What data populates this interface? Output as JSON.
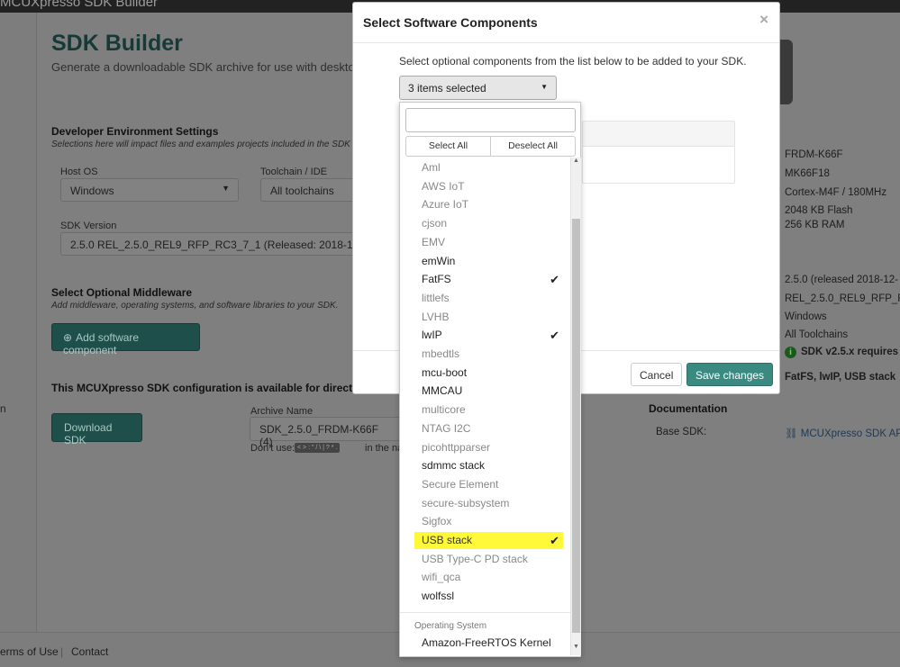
{
  "app": {
    "title": "MCUXpresso SDK Builder"
  },
  "page": {
    "title": "SDK Builder",
    "subtitle": "Generate a downloadable SDK archive for use with desktop",
    "dev_env": {
      "heading": "Developer Environment Settings",
      "desc": "Selections here will impact files and examples projects included in the SDK a",
      "host_os_label": "Host OS",
      "host_os_value": "Windows",
      "toolchain_label": "Toolchain / IDE",
      "toolchain_value": "All toolchains",
      "sdk_version_label": "SDK Version",
      "sdk_version_value": "2.5.0 REL_2.5.0_REL9_RFP_RC3_7_1 (Released: 2018-12-1"
    },
    "middleware": {
      "heading": "Select Optional Middleware",
      "desc": "Add middleware, operating systems, and software libraries to your SDK.",
      "add_button": "Add software component"
    },
    "config_text": "This MCUXpresso SDK configuration is available for direct d",
    "download_button": "Download SDK",
    "archive": {
      "label": "Archive Name",
      "value": "SDK_2.5.0_FRDM-K66F (4)",
      "dont_use": "Don't use:",
      "chars": "< > : \" / \\ | ? * .",
      "suffix": "in the na"
    },
    "left_cut": "n"
  },
  "right_panel": {
    "board": "FRDM-K66F",
    "device": "MK66F18",
    "core": "Cortex-M4F / 180MHz",
    "flash": "2048 KB Flash",
    "ram": "256 KB RAM",
    "sdk_version": "2.5.0  (released 2018-12-",
    "build": "REL_2.5.0_REL9_RFP_R",
    "host_os": "Windows",
    "toolchains": "All Toolchains",
    "requires": "SDK v2.5.x requires",
    "components": "FatFS,  lwIP,  USB stack",
    "doc_heading": "Documentation",
    "doc_label": "Base SDK:",
    "doc_link": "MCUXpresso SDK API"
  },
  "footer": {
    "terms": "erms of Use",
    "contact": "Contact"
  },
  "modal": {
    "title": "Select Software Components",
    "close": "×",
    "instruction": "Select optional components from the list below to be added to your SDK.",
    "dropdown_value": "3 items selected",
    "search_placeholder": "",
    "select_all": "Select All",
    "deselect_all": "Deselect All",
    "items": [
      {
        "label": "Aml",
        "checked": false,
        "style": "dim"
      },
      {
        "label": "AWS IoT",
        "checked": false,
        "style": "dim"
      },
      {
        "label": "Azure IoT",
        "checked": false,
        "style": "dim"
      },
      {
        "label": "cjson",
        "checked": false,
        "style": "dim"
      },
      {
        "label": "EMV",
        "checked": false,
        "style": "dim"
      },
      {
        "label": "emWin",
        "checked": false,
        "style": "dark"
      },
      {
        "label": "FatFS",
        "checked": true,
        "style": "dark"
      },
      {
        "label": "littlefs",
        "checked": false,
        "style": "dim"
      },
      {
        "label": "LVHB",
        "checked": false,
        "style": "dim"
      },
      {
        "label": "lwIP",
        "checked": true,
        "style": "dark"
      },
      {
        "label": "mbedtls",
        "checked": false,
        "style": "dim"
      },
      {
        "label": "mcu-boot",
        "checked": false,
        "style": "dark"
      },
      {
        "label": "MMCAU",
        "checked": false,
        "style": "dark"
      },
      {
        "label": "multicore",
        "checked": false,
        "style": "dim"
      },
      {
        "label": "NTAG I2C",
        "checked": false,
        "style": "dim"
      },
      {
        "label": "picohttpparser",
        "checked": false,
        "style": "dim"
      },
      {
        "label": "sdmmc stack",
        "checked": false,
        "style": "dark"
      },
      {
        "label": "Secure Element",
        "checked": false,
        "style": "dim"
      },
      {
        "label": "secure-subsystem",
        "checked": false,
        "style": "dim"
      },
      {
        "label": "Sigfox",
        "checked": false,
        "style": "dim"
      },
      {
        "label": "USB stack",
        "checked": true,
        "style": "hl"
      },
      {
        "label": "USB Type-C PD stack",
        "checked": false,
        "style": "dim"
      },
      {
        "label": "wifi_qca",
        "checked": false,
        "style": "dim"
      },
      {
        "label": "wolfssl",
        "checked": false,
        "style": "dark"
      }
    ],
    "group_label": "Operating System",
    "os_item": "Amazon-FreeRTOS Kernel",
    "cancel": "Cancel",
    "save": "Save changes"
  }
}
